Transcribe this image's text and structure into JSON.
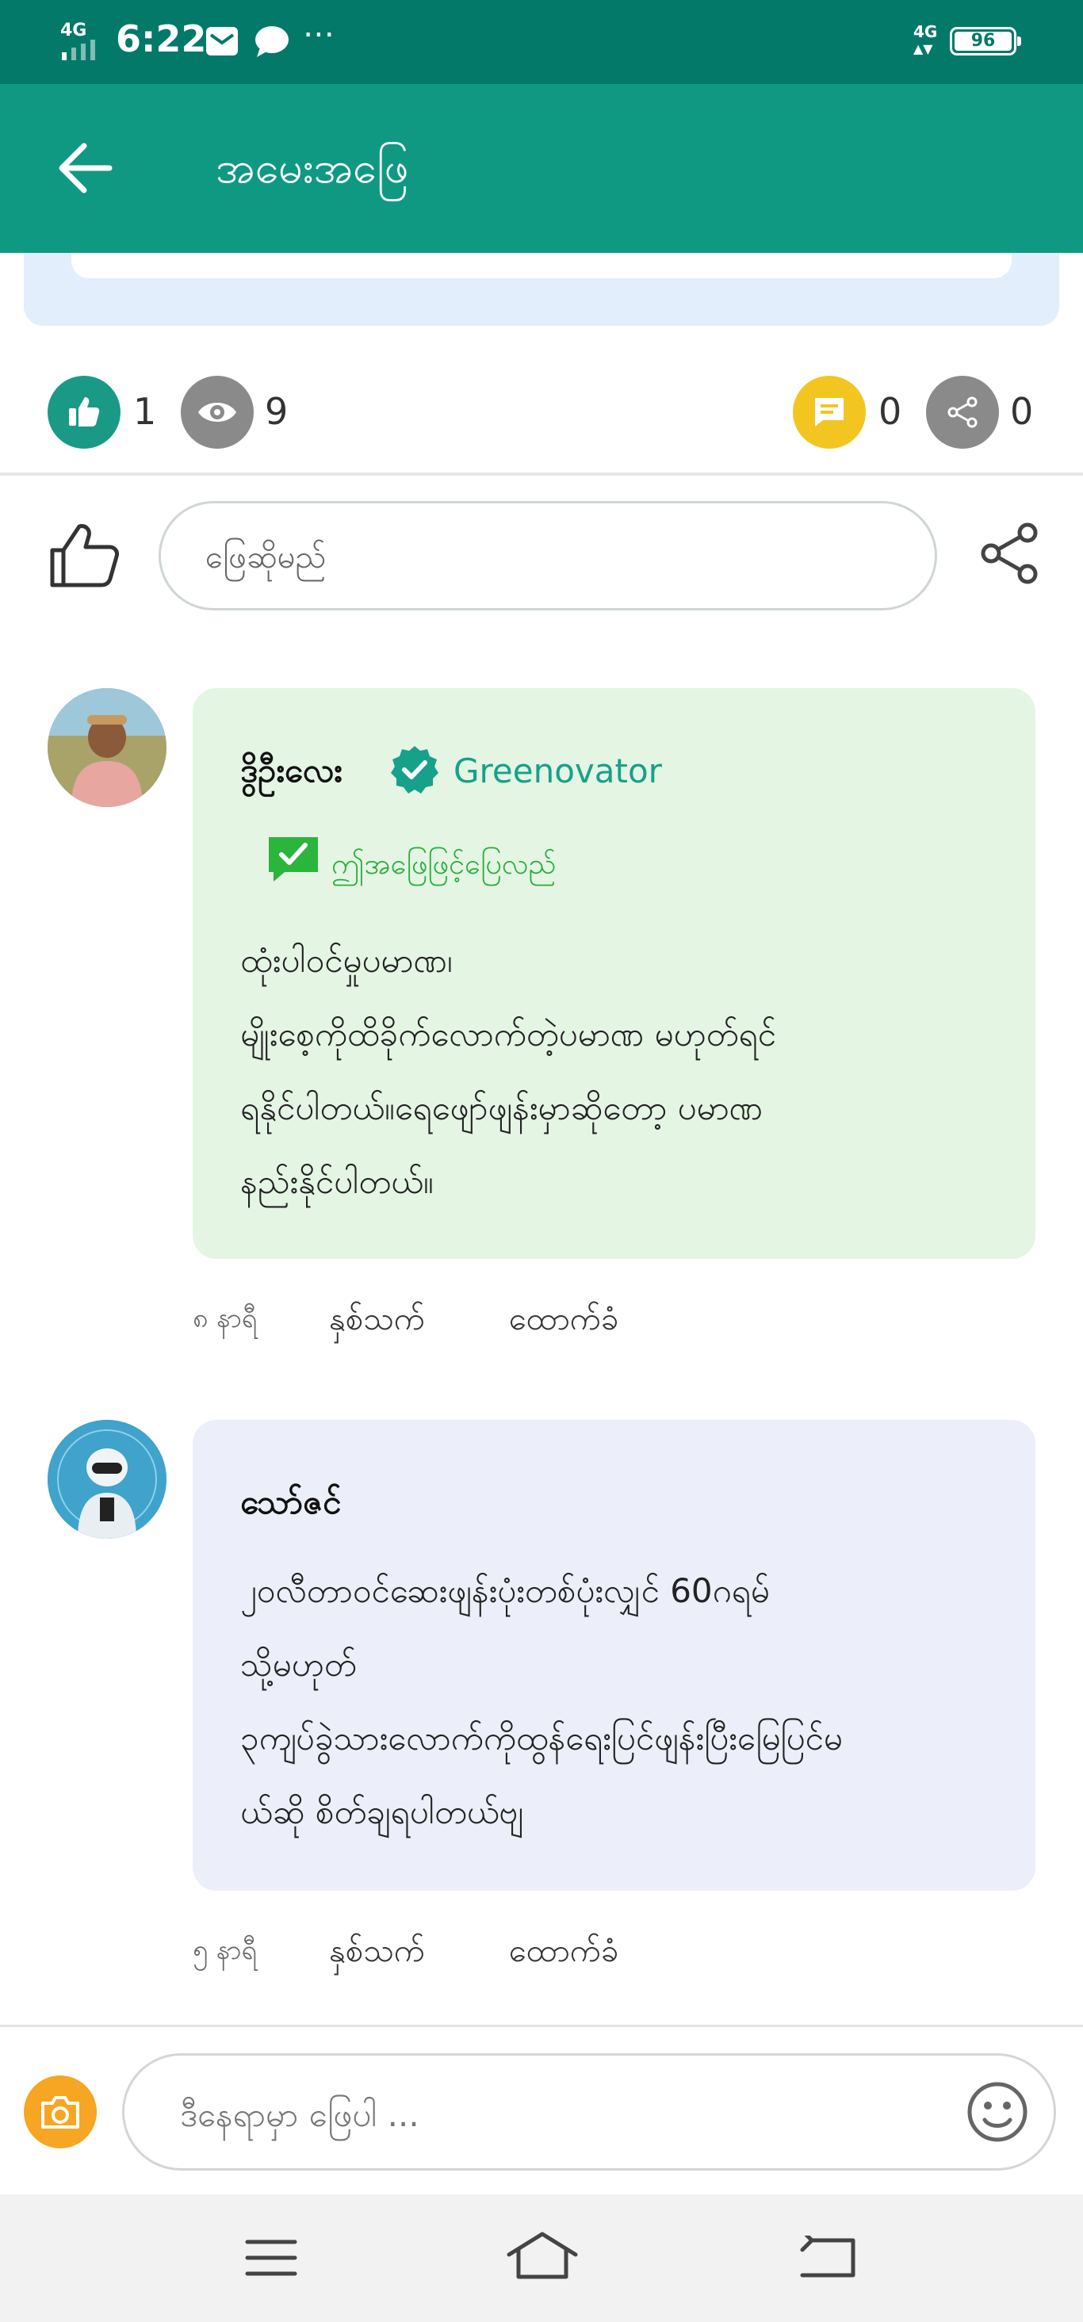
{
  "status_bar": {
    "time": "6:22",
    "network": "4G",
    "battery": "96",
    "more": "⋯"
  },
  "app_bar": {
    "title": "အမေးအဖြေ"
  },
  "stats": {
    "likes": "1",
    "views": "9",
    "comments": "0",
    "shares": "0"
  },
  "answer_bar": {
    "placeholder": "ဖြေဆိုမည်"
  },
  "comments": [
    {
      "author": "ဒွိဦးလေး",
      "role": "Greenovator",
      "verified": true,
      "accepted_label": "ဤအဖြေဖြင့်ပြေလည်",
      "lines": [
        "ထုံးပါဝင်မှုပမာဏ၊",
        "မျိုးစေ့ကိုထိခိုက်လောက်တဲ့ပမာဏ မဟုတ်ရင်",
        "ရနိုင်ပါတယ်။ရေဖျော်ဖျန်းမှာဆိုတော့ ပမာဏ",
        "နည်းနိုင်ပါတယ်။"
      ],
      "time": "၈ နာရီ",
      "like_label": "နှစ်သက်",
      "support_label": "ထောက်ခံ",
      "bubble_color": "#e4f5e4"
    },
    {
      "author": "သော်ဇင်",
      "lines": [
        "၂၀လီတာဝင်ဆေးဖျန်းပုံးတစ်ပုံးလျှင် 60ဂရမ်",
        "သို့မဟုတ်",
        "၃ကျပ်ခွဲသားလောက်ကိုထွန်ရေးပြင်ဖျန်းပြီးမြေပြင်မ",
        "ယ်ဆို စိတ်ချရပါတယ်ဗျ"
      ],
      "time": "၅ နာရီ",
      "like_label": "နှစ်သက်",
      "support_label": "ထောက်ခံ",
      "bubble_color": "#eceef9"
    }
  ],
  "message_bar": {
    "placeholder": "ဒီနေရာမှာ ဖြေပါ ..."
  },
  "colors": {
    "status_bar": "#03796a",
    "app_bar": "#0f9983",
    "accent": "#17a08a",
    "like_circle": "#1a9a86",
    "view_circle": "#8a8a8a",
    "comment_circle": "#f2c521",
    "share_circle": "#8a8a8a",
    "camera_button": "#f6a623"
  }
}
